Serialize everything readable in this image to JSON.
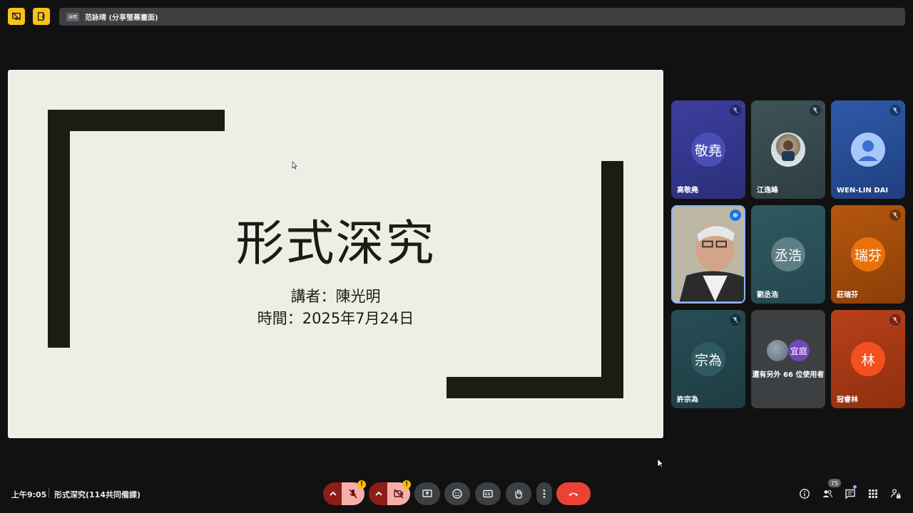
{
  "top_bar": {
    "presenter_avatar_text": "詠晴",
    "share_text": "范詠晴 (分享螢幕畫面)"
  },
  "slide": {
    "title": "形式深究",
    "speaker_line": "講者：陳光明",
    "time_line": "時間：2025年7月24日"
  },
  "participants": [
    {
      "name": "高敬堯",
      "initials": "敬堯",
      "muted": true
    },
    {
      "name": "江逸峰",
      "initials": "",
      "muted": true
    },
    {
      "name": "WEN-LIN DAI",
      "initials": "",
      "muted": true
    },
    {
      "name": "",
      "initials": "",
      "speaking": true
    },
    {
      "name": "劉丞浩",
      "initials": "丞浩",
      "muted": false
    },
    {
      "name": "莊瑞芬",
      "initials": "瑞芬",
      "muted": true
    },
    {
      "name": "許宗為",
      "initials": "宗為",
      "muted": true
    },
    {
      "name": "還有另外 66 位使用者",
      "initials": "宜庭",
      "muted": false
    },
    {
      "name": "冠睿林",
      "initials": "林",
      "muted": true
    }
  ],
  "bottom_bar": {
    "time": "上午9:05",
    "meeting_name": "形式深究(114共同備課)",
    "participant_count": "75",
    "warning_mark": "!"
  },
  "colors": {
    "accent_yellow": "#f9c316",
    "end_call_red": "#ea4335",
    "slide_bg": "#efeee6",
    "slide_bar": "#1c1b14"
  }
}
